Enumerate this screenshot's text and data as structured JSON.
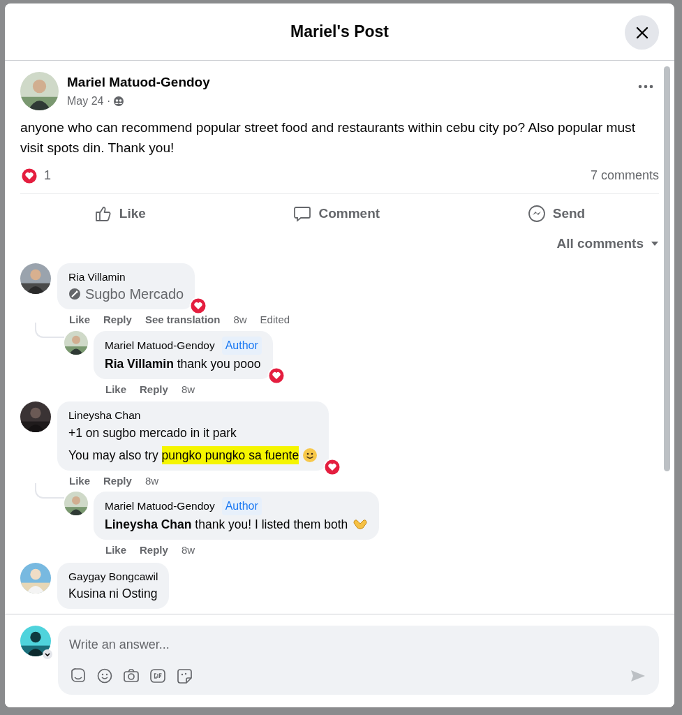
{
  "dialog": {
    "title": "Mariel's Post"
  },
  "post": {
    "author": "Mariel Matuod-Gendoy",
    "date": "May 24 ·",
    "text": "anyone who can recommend popular street food  and restaurants within cebu city po? Also popular must visit spots din. Thank you!",
    "reaction_count": "1",
    "comments_count": "7 comments"
  },
  "actions": [
    {
      "kind": "like",
      "label": "Like"
    },
    {
      "kind": "comment",
      "label": "Comment"
    },
    {
      "kind": "send",
      "label": "Send"
    }
  ],
  "filter": {
    "label": "All comments"
  },
  "comments": [
    {
      "author": "Ria Villamin",
      "lines": [
        [
          {
            "kind": "place",
            "text": "Sugbo Mercado"
          }
        ]
      ],
      "reacted": true,
      "actions": [
        "Like",
        "Reply",
        "See translation"
      ],
      "time": "8w",
      "edited": "Edited",
      "children": [
        {
          "author": "Mariel Matuod-Gendoy",
          "badge": "Author",
          "lines": [
            [
              {
                "kind": "text",
                "text": "**Ria Villamin** thank you pooo"
              }
            ]
          ],
          "reacted": true,
          "actions": [
            "Like",
            "Reply"
          ],
          "time": "8w"
        }
      ]
    },
    {
      "author": "Lineysha Chan",
      "lines": [
        [
          {
            "kind": "text",
            "text": "+1 on sugbo mercado in it park"
          }
        ],
        [
          {
            "kind": "text",
            "text": "You may also try "
          },
          {
            "kind": "text",
            "text": "pungko pungko sa fuente",
            "highlighted": true
          },
          {
            "kind": "smile"
          }
        ]
      ],
      "reacted": true,
      "actions": [
        "Like",
        "Reply"
      ],
      "time": "8w",
      "children": [
        {
          "author": "Mariel Matuod-Gendoy",
          "badge": "Author",
          "lines": [
            [
              {
                "kind": "text",
                "text": "**Lineysha Chan** thank you! I listed them both"
              },
              {
                "kind": "hearthands"
              }
            ]
          ],
          "reacted": false,
          "actions": [
            "Like",
            "Reply"
          ],
          "time": "8w"
        }
      ]
    },
    {
      "author": "Gaygay Bongcawil",
      "lines": [
        [
          {
            "kind": "text",
            "text": "Kusina ni Osting"
          }
        ]
      ],
      "reacted": false
    }
  ],
  "composer": {
    "placeholder": "Write an answer..."
  }
}
